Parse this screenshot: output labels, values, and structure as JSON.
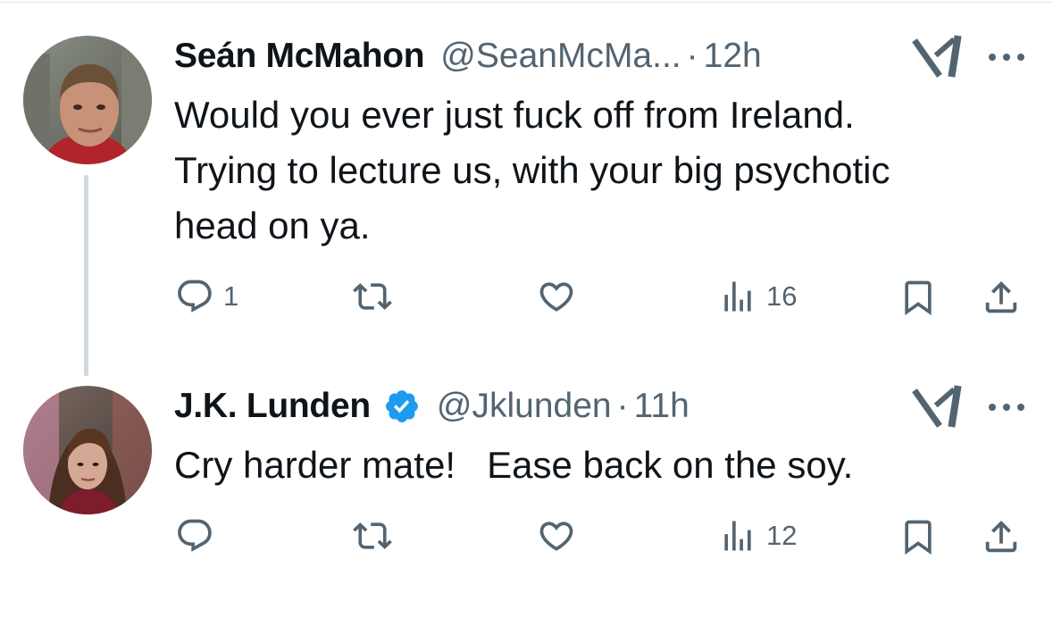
{
  "colors": {
    "text": "#0f1419",
    "secondary": "#536471",
    "verified": "#1d9bf0",
    "thread_line": "#cfd9de"
  },
  "tweets": [
    {
      "name": "Seán McMahon",
      "handle": "@SeanMcMa...",
      "separator": "·",
      "time": "12h",
      "verified": false,
      "text": "Would you ever just fuck off from Ireland.\nTrying to lecture us, with your big psychotic\nhead on ya.",
      "actions": {
        "replies": "1",
        "reposts": "",
        "likes": "",
        "views": "16"
      },
      "icons": [
        "reply-icon",
        "repost-icon",
        "like-icon",
        "views-icon",
        "bookmark-icon",
        "share-icon",
        "grok-icon",
        "more-icon"
      ]
    },
    {
      "name": "J.K. Lunden",
      "handle": "@Jklunden",
      "separator": "·",
      "time": "11h",
      "verified": true,
      "text": "Cry harder mate!   Ease back on the soy.",
      "actions": {
        "replies": "",
        "reposts": "",
        "likes": "",
        "views": "12"
      },
      "icons": [
        "reply-icon",
        "repost-icon",
        "like-icon",
        "views-icon",
        "bookmark-icon",
        "share-icon",
        "grok-icon",
        "more-icon",
        "verified-badge-icon"
      ]
    }
  ]
}
